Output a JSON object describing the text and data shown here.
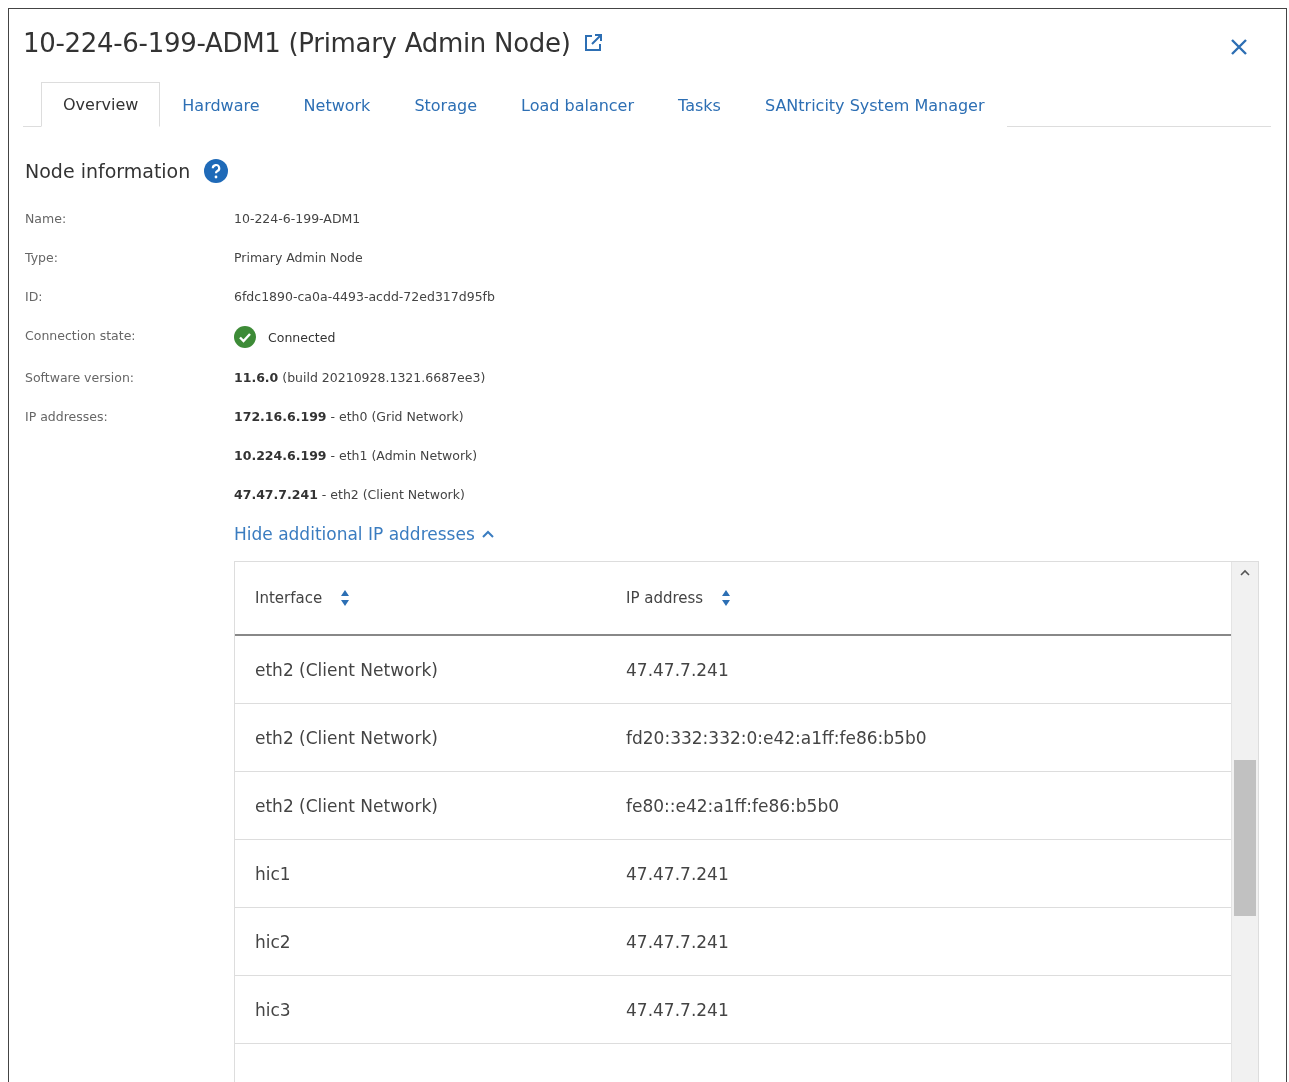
{
  "dialog": {
    "title": "10-224-6-199-ADM1 (Primary Admin Node)"
  },
  "tabs": [
    {
      "label": "Overview",
      "selected": true
    },
    {
      "label": "Hardware",
      "selected": false
    },
    {
      "label": "Network",
      "selected": false
    },
    {
      "label": "Storage",
      "selected": false
    },
    {
      "label": "Load balancer",
      "selected": false
    },
    {
      "label": "Tasks",
      "selected": false
    },
    {
      "label": "SANtricity System Manager",
      "selected": false
    }
  ],
  "section": {
    "title": "Node information"
  },
  "info_rows": [
    {
      "label": "Name:",
      "kind": "text",
      "values": [
        "10-224-6-199-ADM1"
      ]
    },
    {
      "label": "Type:",
      "kind": "text",
      "values": [
        "Primary Admin Node"
      ]
    },
    {
      "label": "ID:",
      "kind": "text",
      "values": [
        "6fdc1890-ca0a-4493-acdd-72ed317d95fb"
      ]
    },
    {
      "label": "Connection state:",
      "kind": "status",
      "values": [
        "Connected"
      ]
    },
    {
      "label": "Software version:",
      "kind": "text",
      "values": [
        "**11.6.0** (build 20210928.1321.6687ee3)"
      ]
    },
    {
      "label": "IP addresses:",
      "kind": "text",
      "values": [
        "**172.16.6.199** - eth0 (Grid Network)",
        "**10.224.6.199** - eth1 (Admin Network)",
        "**47.47.7.241** - eth2 (Client Network)"
      ]
    }
  ],
  "toggle_link": {
    "label": "Hide additional IP addresses",
    "expanded": true
  },
  "table": {
    "columns": [
      "Interface",
      "IP address"
    ],
    "rows": [
      [
        "eth2 (Client Network)",
        "47.47.7.241"
      ],
      [
        "eth2 (Client Network)",
        "fd20:332:332:0:e42:a1ff:fe86:b5b0"
      ],
      [
        "eth2 (Client Network)",
        "fe80::e42:a1ff:fe86:b5b0"
      ],
      [
        "hic1",
        "47.47.7.241"
      ],
      [
        "hic2",
        "47.47.7.241"
      ],
      [
        "hic3",
        "47.47.7.241"
      ]
    ]
  }
}
